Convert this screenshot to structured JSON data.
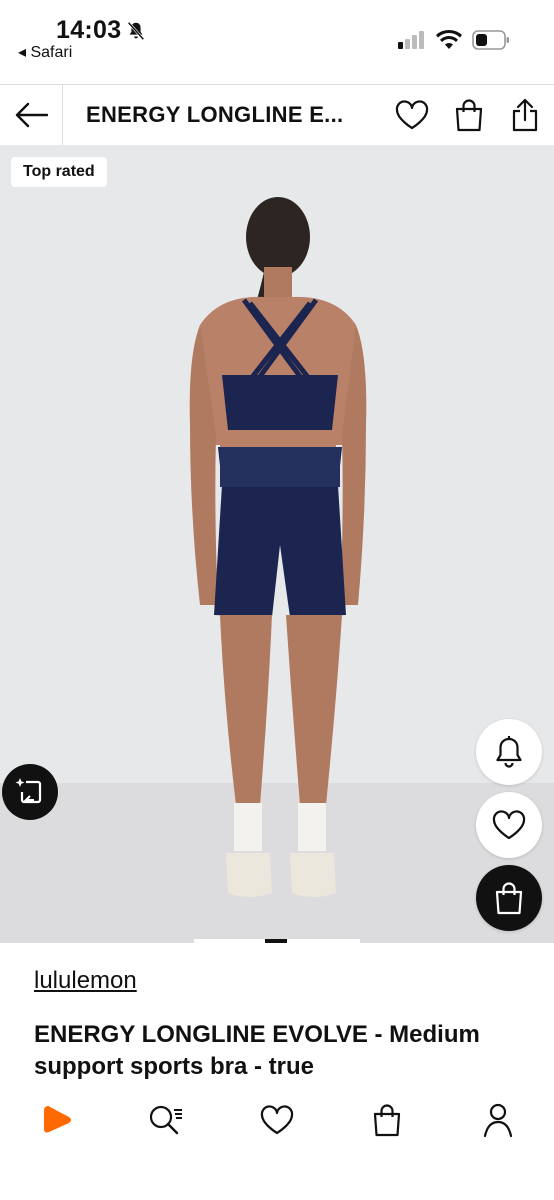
{
  "status_bar": {
    "time": "14:03",
    "back_app": "◂ Safari"
  },
  "nav": {
    "title": "ENERGY LONGLINE E..."
  },
  "hero": {
    "badge": "Top rated"
  },
  "product": {
    "brand": "lululemon",
    "title": "ENERGY LONGLINE EVOLVE - Medium support sports bra - true"
  },
  "colors": {
    "accent": "#ff6900",
    "hero_bg": "#e7e8ea",
    "garment": "#1b2550"
  },
  "icons": [
    "back-arrow-icon",
    "heart-icon",
    "bag-icon",
    "share-icon",
    "bell-icon",
    "ai-try-on-icon",
    "home-icon",
    "search-icon",
    "profile-icon"
  ]
}
